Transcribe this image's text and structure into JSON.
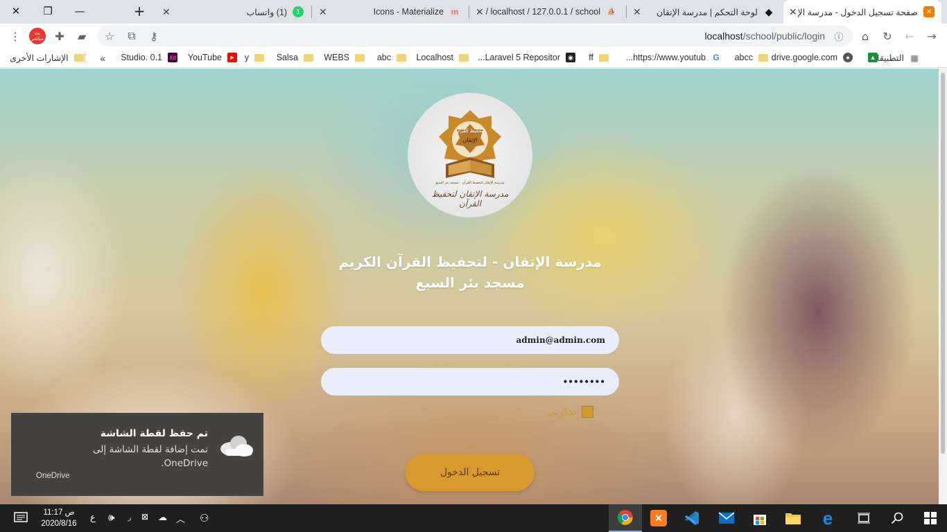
{
  "browser": {
    "tabs": [
      {
        "title": "صفحة تسجيل الدخول - مدرسة الإ",
        "active": true
      },
      {
        "title": "لوحة التحكم | مدرسة الإتقان"
      },
      {
        "title": "localhost / 127.0.0.1 / school /"
      },
      {
        "title": "Icons - Materialize"
      },
      {
        "title": "(1) واتساب",
        "badge": "1"
      }
    ],
    "new_tab": "+",
    "url_host": "localhost",
    "url_path": "/school/public/login",
    "profile_label": "بث مباشر"
  },
  "bookmarks": {
    "apps": "التطبيقات",
    "items": [
      "drive.google.com",
      "abcc",
      "https://www.youtub...",
      "ff",
      "Laravel 5 Repositor...",
      "Localhost",
      "abc",
      "WEBS",
      "Salsa",
      "y",
      "YouTube",
      "Studio. 0.1"
    ],
    "more": "»",
    "other": "الإشارات الأخرى"
  },
  "page": {
    "logo_text_top": "لتحفيظ القرآن",
    "logo_text_mid": "الإتقان",
    "logo_caption": "مدرسة الإتقان لتحفيظ القرآن - مسجد بئر السبع",
    "logo_script": "مدرسة الإتقان لتحفيظ القرآن",
    "title_line1": "مدرسة الإتقان - لتحفيظ القرآن الكريم",
    "title_line2": "مسجد بئر السبع",
    "email_value": "admin@admin.com",
    "password_value": "••••••••",
    "remember_label": "تذكرني",
    "login_button": "تسجيل الدخول"
  },
  "toast": {
    "title": "تم حفظ لقطة الشاشة",
    "body": "تمت إضافة لقطة الشاشة إلى OneDrive.",
    "app": "OneDrive"
  },
  "taskbar": {
    "time": "11:17 ص",
    "date": "2020/8/16",
    "lang": "ع"
  },
  "colors": {
    "accent": "#d89a2e",
    "input_bg": "#e8eefb",
    "toast_bg": "#454240",
    "taskbar_bg": "#1f1f1f"
  }
}
